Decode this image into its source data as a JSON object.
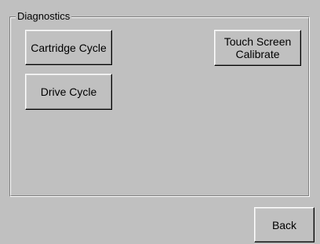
{
  "diagnostics": {
    "group_label": "Diagnostics",
    "buttons": {
      "cartridge_cycle": "Cartridge Cycle",
      "drive_cycle": "Drive Cycle",
      "touch_screen_calibrate": "Touch Screen\nCalibrate"
    }
  },
  "footer": {
    "back_label": "Back"
  }
}
